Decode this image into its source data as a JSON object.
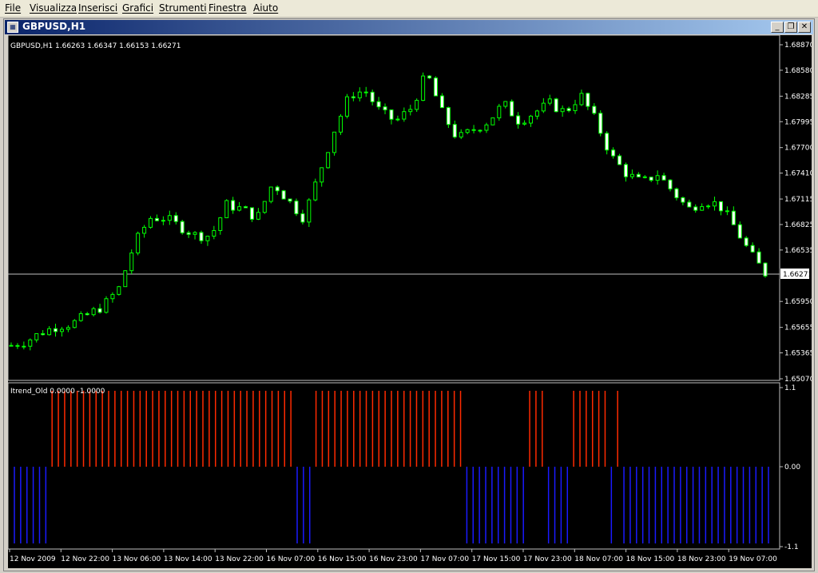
{
  "menu": {
    "items": [
      "File",
      "Visualizza",
      "Inserisci",
      "Grafici",
      "Strumenti",
      "Finestra",
      "Aiuto"
    ]
  },
  "window": {
    "title": "GBPUSD,H1",
    "icon": "chart-window-icon",
    "controls": [
      "minimize-icon",
      "restore-icon",
      "close-icon"
    ]
  },
  "main_chart": {
    "label": "GBPUSD,H1  1.66263 1.66347 1.66153 1.66271",
    "price_marker": "1.66271",
    "price_ticks": [
      "1.68870",
      "1.68580",
      "1.68285",
      "1.67995",
      "1.67700",
      "1.67410",
      "1.67115",
      "1.66825",
      "1.66535",
      "1.66271",
      "1.65950",
      "1.65655",
      "1.65365",
      "1.65070"
    ],
    "time_labels": [
      "12 Nov 2009",
      "12 Nov 22:00",
      "13 Nov 06:00",
      "13 Nov 14:00",
      "13 Nov 22:00",
      "16 Nov 07:00",
      "16 Nov 15:00",
      "16 Nov 23:00",
      "17 Nov 07:00",
      "17 Nov 15:00",
      "17 Nov 23:00",
      "18 Nov 07:00",
      "18 Nov 15:00",
      "18 Nov 23:00",
      "19 Nov 07:00"
    ]
  },
  "indicator": {
    "label": "Itrend_Old 0.0000 -1.0000",
    "ticks": [
      "1.1",
      "0.00",
      "-1.1"
    ]
  },
  "colors": {
    "background": "#000000",
    "candle": "#00ff00",
    "up_body": "#000000",
    "down_body": "#ffffff",
    "text": "#ffffff",
    "grid": "#c0c0c0",
    "positive_hist": "#ff2a00",
    "negative_hist": "#1a1aff"
  },
  "chart_data": {
    "type": "candlestick",
    "symbol": "GBPUSD",
    "timeframe": "H1",
    "ohlc": {
      "open": 1.66263,
      "high": 1.66347,
      "low": 1.66153,
      "close": 1.66271
    },
    "ylim": [
      1.6507,
      1.6887
    ],
    "y_tick_labels": [
      "1.68870",
      "1.68580",
      "1.68285",
      "1.67995",
      "1.67700",
      "1.67410",
      "1.67115",
      "1.66825",
      "1.66535",
      "1.65950",
      "1.65655",
      "1.65365",
      "1.65070"
    ],
    "x_tick_labels": [
      "12 Nov 2009",
      "12 Nov 22:00",
      "13 Nov 06:00",
      "13 Nov 14:00",
      "13 Nov 22:00",
      "16 Nov 07:00",
      "16 Nov 15:00",
      "16 Nov 23:00",
      "17 Nov 07:00",
      "17 Nov 15:00",
      "17 Nov 23:00",
      "18 Nov 07:00",
      "18 Nov 15:00",
      "18 Nov 23:00",
      "19 Nov 07:00"
    ],
    "close_path": [
      1.6545,
      1.655,
      1.656,
      1.6567,
      1.657,
      1.658,
      1.659,
      1.661,
      1.666,
      1.669,
      1.669,
      1.668,
      1.667,
      1.667,
      1.6705,
      1.67,
      1.669,
      1.673,
      1.671,
      1.669,
      1.674,
      1.679,
      1.683,
      1.6835,
      1.681,
      1.68,
      1.6815,
      1.6855,
      1.681,
      1.678,
      1.679,
      1.68,
      1.682,
      1.68,
      1.681,
      1.682,
      1.681,
      1.683,
      1.68,
      1.676,
      1.674,
      1.673,
      1.674,
      1.672,
      1.67,
      1.671,
      1.6705,
      1.668,
      1.665,
      1.6627
    ],
    "indicator": {
      "name": "Itrend_Old",
      "values": [
        0.0,
        -1.0
      ],
      "ylim": [
        -1.1,
        1.1
      ],
      "sequence": [
        -1,
        -1,
        -1,
        -1,
        -1,
        -1,
        1,
        1,
        1,
        1,
        1,
        1,
        1,
        1,
        1,
        1,
        1,
        1,
        1,
        1,
        1,
        1,
        1,
        1,
        1,
        1,
        1,
        1,
        1,
        1,
        1,
        1,
        1,
        1,
        1,
        1,
        1,
        1,
        1,
        1,
        1,
        1,
        1,
        1,
        1,
        -1,
        -1,
        -1,
        1,
        1,
        1,
        1,
        1,
        1,
        1,
        1,
        1,
        1,
        1,
        1,
        1,
        1,
        1,
        1,
        1,
        1,
        1,
        1,
        1,
        1,
        1,
        1,
        -1,
        -1,
        -1,
        -1,
        -1,
        -1,
        -1,
        -1,
        -1,
        -1,
        1,
        1,
        1,
        -1,
        -1,
        -1,
        -1,
        1,
        1,
        1,
        1,
        1,
        1,
        -1,
        1,
        -1,
        -1,
        -1,
        -1,
        -1,
        -1,
        -1,
        -1,
        -1,
        -1,
        -1,
        -1,
        -1,
        -1,
        -1,
        -1,
        -1,
        -1,
        -1,
        -1,
        -1,
        -1,
        -1,
        -1
      ]
    }
  }
}
